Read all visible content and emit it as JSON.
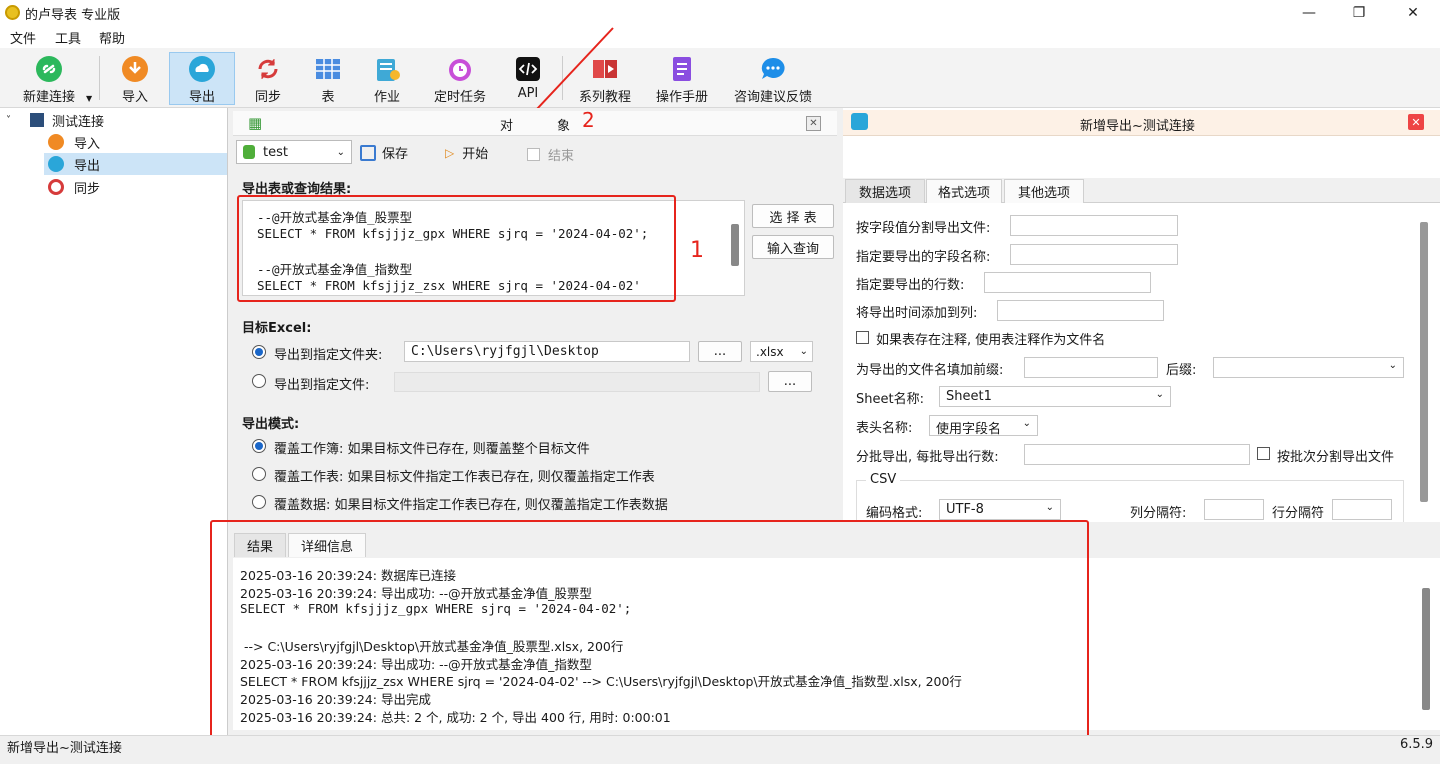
{
  "window": {
    "title": "的卢导表 专业版",
    "minimize": "—",
    "maximize": "❐",
    "close": "✕"
  },
  "menu": [
    "文件",
    "工具",
    "帮助"
  ],
  "toolbar": {
    "new_connection": "新建连接",
    "import": "导入",
    "export": "导出",
    "sync": "同步",
    "table": "表",
    "job": "作业",
    "scheduled_task": "定时任务",
    "api": "API",
    "tutorials": "系列教程",
    "manual": "操作手册",
    "feedback": "咨询建议反馈"
  },
  "tree": {
    "root": "测试连接",
    "children": [
      "导入",
      "导出",
      "同步"
    ]
  },
  "object_panel": {
    "title_left": "对",
    "title_right": "象",
    "db_select": "test",
    "save": "保存",
    "start": "开始",
    "end": "结束"
  },
  "annotations": {
    "marker1": "1",
    "marker2": "2"
  },
  "export_section": {
    "label": "导出表或查询结果:",
    "sql_lines": [
      "--@开放式基金净值_股票型",
      "SELECT * FROM kfsjjjz_gpx WHERE sjrq = '2024-04-02';",
      "",
      "--@开放式基金净值_指数型",
      "SELECT * FROM kfsjjjz_zsx WHERE sjrq = '2024-04-02'"
    ],
    "select_table": "选 择 表",
    "input_query": "输入查询"
  },
  "target_excel": {
    "label": "目标Excel:",
    "to_folder": "导出到指定文件夹:",
    "folder_path": "C:\\Users\\ryjfgjl\\Desktop",
    "browse": "...",
    "ext": ".xlsx",
    "to_file": "导出到指定文件:",
    "browse2": "..."
  },
  "export_mode": {
    "label": "导出模式:",
    "options": [
      "覆盖工作簿: 如果目标文件已存在, 则覆盖整个目标文件",
      "覆盖工作表: 如果目标文件指定工作表已存在, 则仅覆盖指定工作表",
      "覆盖数据: 如果目标文件指定工作表已存在, 则仅覆盖指定工作表数据"
    ]
  },
  "right_panel": {
    "title": "新增导出~测试连接",
    "tabs": [
      "数据选项",
      "格式选项",
      "其他选项"
    ],
    "split_by_field": "按字段值分割导出文件:",
    "fields": "指定要导出的字段名称:",
    "rows": "指定要导出的行数:",
    "add_time_col": "将导出时间添加到列:",
    "use_comment": "如果表存在注释, 使用表注释作为文件名",
    "prefix": "为导出的文件名填加前缀:",
    "suffix": "后缀:",
    "sheet_name_label": "Sheet名称:",
    "sheet_name": "Sheet1",
    "header_label": "表头名称:",
    "header_value": "使用字段名",
    "batch_label": "分批导出, 每批导出行数:",
    "batch_split": "按批次分割导出文件",
    "csv_label": "CSV",
    "encoding_label": "编码格式:",
    "encoding": "UTF-8",
    "col_sep": "列分隔符:",
    "row_sep": "行分隔符"
  },
  "log": {
    "tabs": [
      "结果",
      "详细信息"
    ],
    "lines": [
      "2025-03-16 20:39:24: 数据库已连接",
      "2025-03-16 20:39:24: 导出成功: --@开放式基金净值_股票型",
      "SELECT * FROM kfsjjjz_gpx WHERE sjrq = '2024-04-02';",
      "",
      " --> C:\\Users\\ryjfgjl\\Desktop\\开放式基金净值_股票型.xlsx, 200行",
      "2025-03-16 20:39:24: 导出成功: --@开放式基金净值_指数型",
      "SELECT * FROM kfsjjjz_zsx WHERE sjrq = '2024-04-02' --> C:\\Users\\ryjfgjl\\Desktop\\开放式基金净值_指数型.xlsx, 200行",
      "2025-03-16 20:39:24: 导出完成",
      "2025-03-16 20:39:24: 总共: 2 个, 成功: 2 个, 导出 400 行, 用时: 0:00:01"
    ]
  },
  "status": {
    "left": "新增导出~测试连接",
    "version": "6.5.9"
  },
  "colors": {
    "annotation_red": "#e6241c",
    "selected_blue": "#cce4f7"
  }
}
